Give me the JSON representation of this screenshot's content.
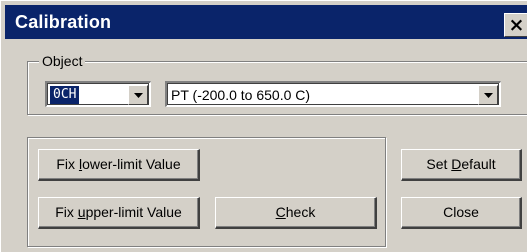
{
  "window": {
    "title": "Calibration",
    "close_glyph": "×"
  },
  "object_group": {
    "label": "Object",
    "channel": {
      "selected": "0CH"
    },
    "sensor": {
      "selected": "PT (-200.0 to 650.0 C)"
    }
  },
  "buttons": {
    "fix_lower": {
      "pre": "Fix ",
      "accel": "l",
      "post": "ower-limit Value"
    },
    "fix_upper": {
      "pre": "Fix ",
      "accel": "u",
      "post": "pper-limit Value"
    },
    "check": {
      "pre": "",
      "accel": "C",
      "post": "heck"
    },
    "set_default": {
      "pre": "Set ",
      "accel": "D",
      "post": "efault"
    },
    "close": {
      "label": "Close"
    }
  },
  "colors": {
    "face": "#d4d0c8",
    "titlebar": "#0a246a",
    "selection": "#0a246a"
  },
  "icons": {
    "dropdown": "chevron-down-icon",
    "close": "close-icon"
  }
}
